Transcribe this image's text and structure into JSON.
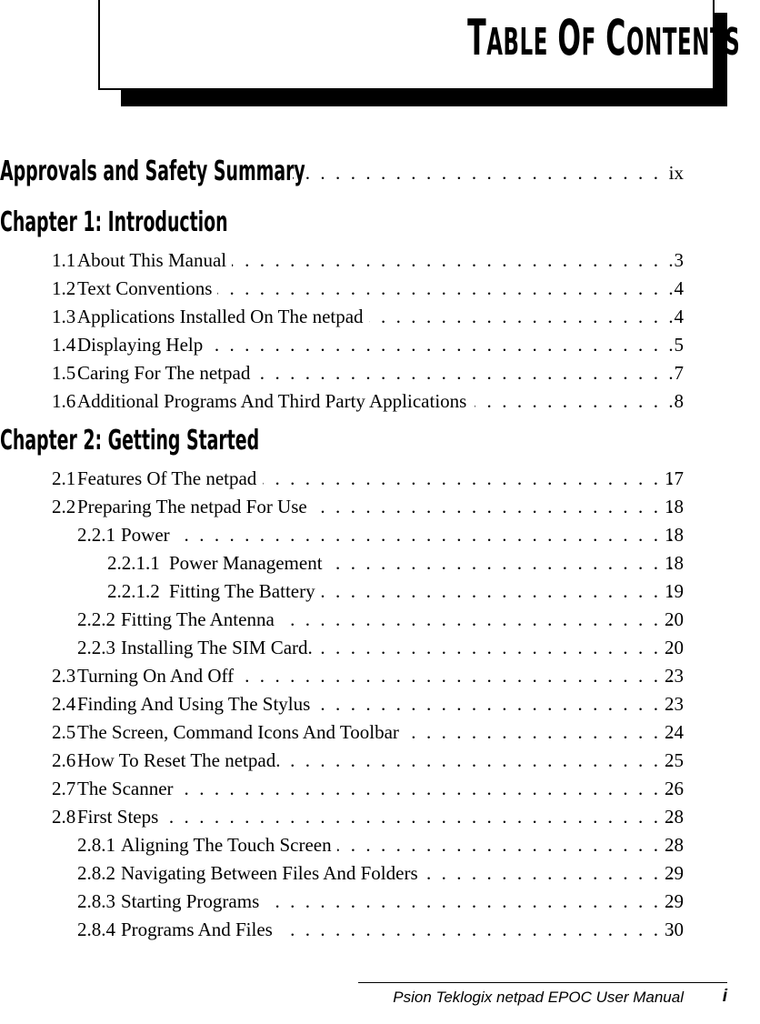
{
  "header": {
    "title_main": "T",
    "title": "TABLE OF CONTENTS",
    "title_parts": [
      {
        "big": "T",
        "small": "ABLE"
      },
      {
        "big": "O",
        "small": "F"
      },
      {
        "big": "C",
        "small": "ONTENTS"
      }
    ]
  },
  "toc": {
    "approvals": {
      "label": "Approvals and Safety Summary",
      "page": "ix"
    },
    "chapters": [
      {
        "heading": "Chapter 1:  Introduction",
        "entries": [
          {
            "level": 1,
            "num": "1.1",
            "title": "About This Manual",
            "page": "3"
          },
          {
            "level": 1,
            "num": "1.2",
            "title": "Text Conventions",
            "page": "4"
          },
          {
            "level": 1,
            "num": "1.3",
            "title": "Applications Installed On The netpad",
            "page": "4"
          },
          {
            "level": 1,
            "num": "1.4",
            "title": "Displaying Help",
            "page": "5"
          },
          {
            "level": 1,
            "num": "1.5",
            "title": "Caring For The netpad",
            "page": "7"
          },
          {
            "level": 1,
            "num": "1.6",
            "title": "Additional Programs And Third Party Applications",
            "page": "8"
          }
        ]
      },
      {
        "heading": "Chapter 2:  Getting Started",
        "entries": [
          {
            "level": 1,
            "num": "2.1",
            "title": "Features Of The netpad",
            "page": "17"
          },
          {
            "level": 1,
            "num": "2.2",
            "title": "Preparing The netpad For Use",
            "page": "18"
          },
          {
            "level": 2,
            "num": "2.2.1",
            "title": "Power",
            "page": "18"
          },
          {
            "level": 3,
            "num": "2.2.1.1",
            "title": "Power Management",
            "page": "18"
          },
          {
            "level": 3,
            "num": "2.2.1.2",
            "title": "Fitting The Battery",
            "page": "19"
          },
          {
            "level": 2,
            "num": "2.2.2",
            "title": "Fitting The Antenna",
            "page": "20"
          },
          {
            "level": 2,
            "num": "2.2.3",
            "title": "Installing The SIM Card.",
            "page": "20"
          },
          {
            "level": 1,
            "num": "2.3",
            "title": "Turning On And Off",
            "page": "23"
          },
          {
            "level": 1,
            "num": "2.4",
            "title": "Finding And Using The Stylus",
            "page": "23"
          },
          {
            "level": 1,
            "num": "2.5",
            "title": "The Screen, Command Icons And Toolbar",
            "page": "24"
          },
          {
            "level": 1,
            "num": "2.6",
            "title": "How To Reset The netpad.",
            "page": "25"
          },
          {
            "level": 1,
            "num": "2.7",
            "title": "The Scanner",
            "page": "26"
          },
          {
            "level": 1,
            "num": "2.8",
            "title": "First Steps",
            "page": "28"
          },
          {
            "level": 2,
            "num": "2.8.1",
            "title": "Aligning The Touch Screen",
            "page": "28"
          },
          {
            "level": 2,
            "num": "2.8.2",
            "title": "Navigating Between Files And Folders",
            "page": "29"
          },
          {
            "level": 2,
            "num": "2.8.3",
            "title": "Starting Programs",
            "page": "29"
          },
          {
            "level": 2,
            "num": "2.8.4",
            "title": "Programs And Files",
            "page": "30"
          }
        ]
      }
    ]
  },
  "footer": {
    "text": "Psion Teklogix netpad EPOC User Manual",
    "page": "i"
  }
}
